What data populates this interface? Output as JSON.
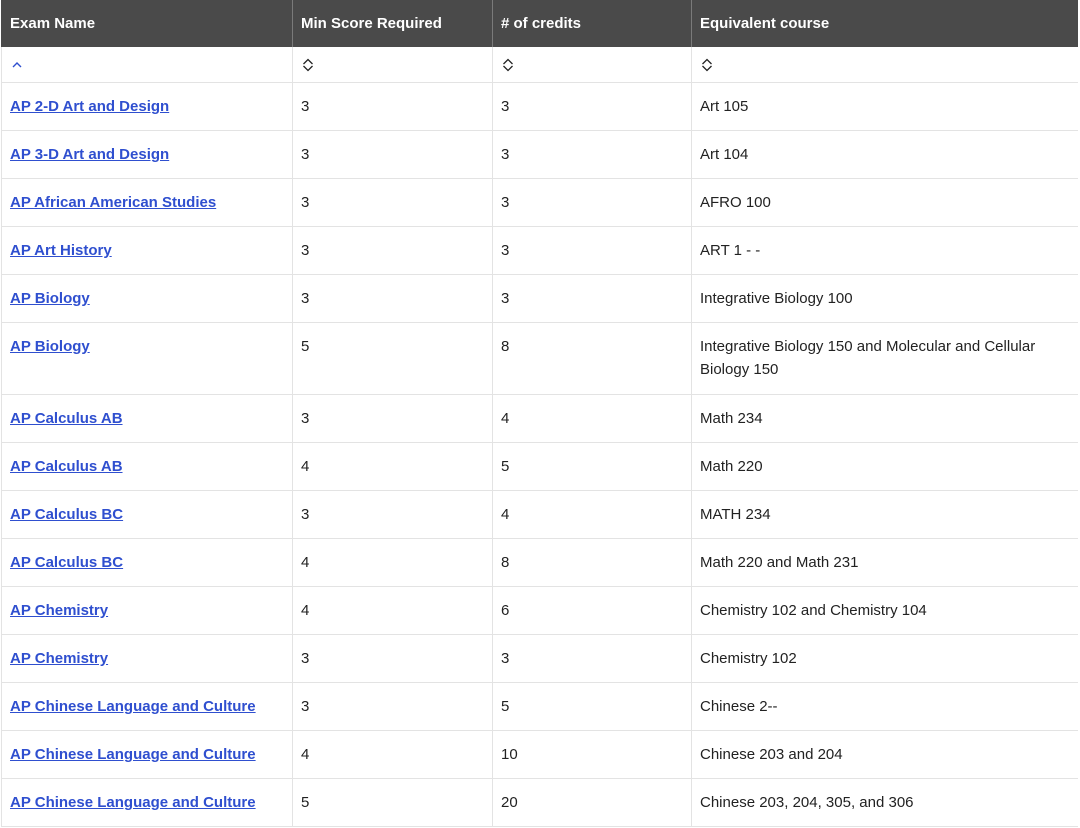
{
  "table": {
    "headers": [
      "Exam Name",
      "Min Score Required",
      "# of credits",
      "Equivalent course"
    ],
    "sort_icons": [
      "sort-ascending-icon",
      "sort-both-icon",
      "sort-both-icon",
      "sort-both-icon"
    ],
    "rows": [
      {
        "exam": "AP 2-D Art and Design",
        "min_score": "3",
        "credits": "3",
        "course": "Art 105"
      },
      {
        "exam": "AP 3-D Art and Design",
        "min_score": "3",
        "credits": "3",
        "course": "Art 104"
      },
      {
        "exam": "AP African American Studies",
        "min_score": "3",
        "credits": "3",
        "course": "AFRO 100"
      },
      {
        "exam": "AP Art History",
        "min_score": "3",
        "credits": "3",
        "course": "ART 1 - -"
      },
      {
        "exam": "AP Biology",
        "min_score": "3",
        "credits": "3",
        "course": "Integrative Biology 100"
      },
      {
        "exam": "AP Biology",
        "min_score": "5",
        "credits": "8",
        "course": "Integrative Biology 150 and Molecular and Cellular Biology 150"
      },
      {
        "exam": "AP Calculus AB",
        "min_score": "3",
        "credits": "4",
        "course": "Math 234"
      },
      {
        "exam": "AP Calculus AB",
        "min_score": "4",
        "credits": "5",
        "course": "Math 220"
      },
      {
        "exam": "AP Calculus BC",
        "min_score": "3",
        "credits": "4",
        "course": "MATH 234"
      },
      {
        "exam": "AP Calculus BC",
        "min_score": "4",
        "credits": "8",
        "course": "Math 220 and Math 231"
      },
      {
        "exam": "AP Chemistry",
        "min_score": "4",
        "credits": "6",
        "course": "Chemistry 102 and Chemistry 104"
      },
      {
        "exam": "AP Chemistry",
        "min_score": "3",
        "credits": "3",
        "course": "Chemistry 102"
      },
      {
        "exam": "AP Chinese Language and Culture",
        "min_score": "3",
        "credits": "5",
        "course": "Chinese 2--"
      },
      {
        "exam": "AP Chinese Language and Culture",
        "min_score": "4",
        "credits": "10",
        "course": "Chinese 203 and 204"
      },
      {
        "exam": "AP Chinese Language and Culture",
        "min_score": "5",
        "credits": "20",
        "course": "Chinese 203, 204, 305, and 306"
      }
    ]
  }
}
